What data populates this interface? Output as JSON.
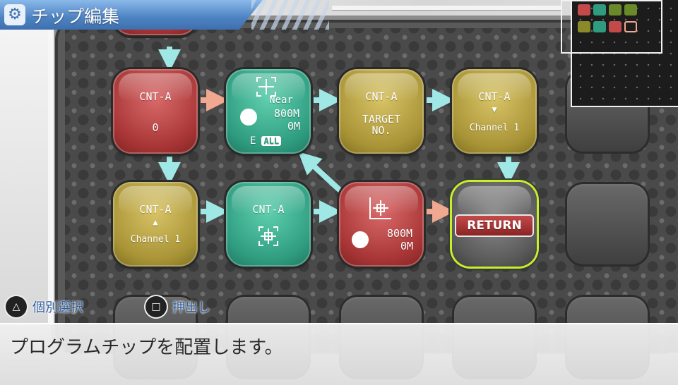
{
  "header": {
    "title": "チップ編集",
    "icon": "gear-icon"
  },
  "colors": {
    "red_chip": "#a83535",
    "teal_chip": "#2f9c80",
    "gold_chip": "#a89436",
    "arrow_red": "#f0a890",
    "arrow_teal": "#9fe8e6",
    "return_outline": "#c7ef2a",
    "header_blue": "#4d83c2"
  },
  "chips": {
    "r1c1": {
      "type": "red",
      "line1": "CNT-A",
      "line2": "0"
    },
    "r1c2": {
      "type": "teal",
      "near": "Near",
      "dist1": "800M",
      "dist2": "0M",
      "e": "E",
      "badge": "ALL",
      "icon": "crosshair-icon"
    },
    "r1c3": {
      "type": "gold",
      "line1": "CNT-A",
      "line2": "TARGET",
      "line3": "NO."
    },
    "r1c4": {
      "type": "gold",
      "line1": "CNT-A",
      "arrow": "▼",
      "line2": "Channel 1"
    },
    "r2c1": {
      "type": "gold",
      "line1": "CNT-A",
      "arrow": "▲",
      "line2": "Channel 1"
    },
    "r2c2": {
      "type": "teal",
      "line1": "CNT-A",
      "icon": "crosshair-icon"
    },
    "r2c3": {
      "type": "red",
      "dist1": "800M",
      "dist2": "0M",
      "icon": "crosshair-icon"
    },
    "r2c4": {
      "type": "return",
      "label": "RETURN"
    }
  },
  "buttons": {
    "triangle": {
      "symbol": "△",
      "label": "個別選択"
    },
    "square": {
      "symbol": "□",
      "label": "押出し"
    }
  },
  "message": "プログラムチップを配置します。"
}
